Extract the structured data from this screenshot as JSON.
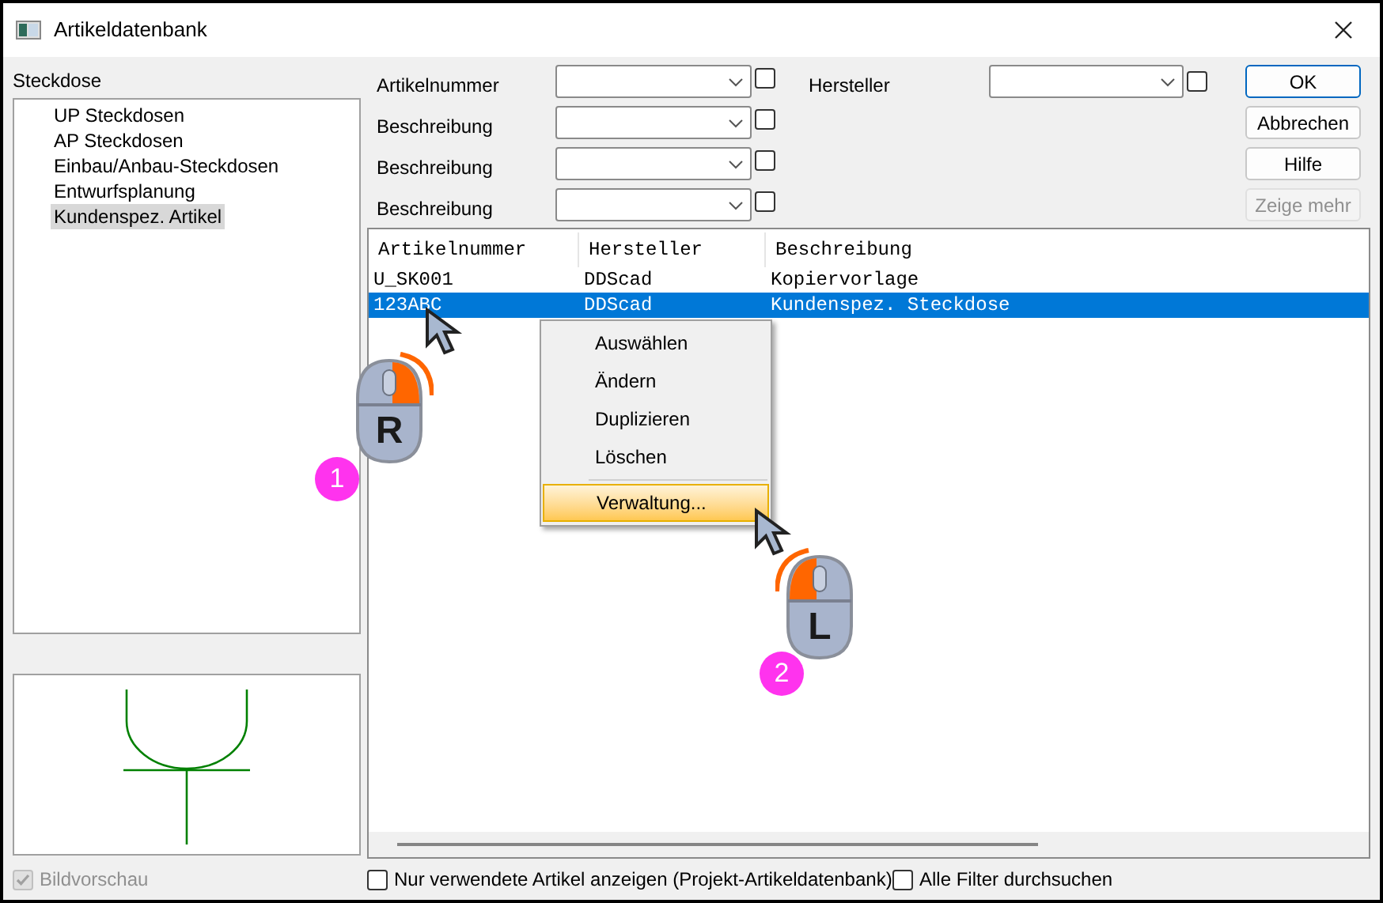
{
  "window": {
    "title": "Artikeldatenbank"
  },
  "category": {
    "label": "Steckdose"
  },
  "tree": [
    {
      "label": "UP Steckdosen",
      "selected": false
    },
    {
      "label": "AP Steckdosen",
      "selected": false
    },
    {
      "label": "Einbau/Anbau-Steckdosen",
      "selected": false
    },
    {
      "label": "Entwurfsplanung",
      "selected": false
    },
    {
      "label": "Kundenspez. Artikel",
      "selected": true
    }
  ],
  "preview": {
    "label": "Bildvorschau",
    "checked": true,
    "disabled": true
  },
  "filters": [
    {
      "label": "Artikelnummer",
      "checked": false
    },
    {
      "label": "Beschreibung",
      "checked": false
    },
    {
      "label": "Beschreibung",
      "checked": false
    },
    {
      "label": "Beschreibung",
      "checked": false
    }
  ],
  "manufacturer_filter": {
    "label": "Hersteller",
    "checked": false
  },
  "buttons": [
    {
      "label": "OK",
      "default": true,
      "disabled": false
    },
    {
      "label": "Abbrechen",
      "default": false,
      "disabled": false
    },
    {
      "label": "Hilfe",
      "default": false,
      "disabled": false
    },
    {
      "label": "Zeige mehr",
      "default": false,
      "disabled": true
    }
  ],
  "table": {
    "columns": [
      "Artikelnummer",
      "Hersteller",
      "Beschreibung"
    ],
    "rows": [
      {
        "cells": [
          "U_SK001",
          "DDScad",
          "Kopiervorlage"
        ],
        "selected": false
      },
      {
        "cells": [
          "123ABC",
          "DDScad",
          "Kundenspez. Steckdose"
        ],
        "selected": true
      }
    ]
  },
  "context_menu": [
    {
      "label": "Auswählen",
      "selected": false
    },
    {
      "label": "Ändern",
      "selected": false
    },
    {
      "label": "Duplizieren",
      "selected": false
    },
    {
      "label": "Löschen",
      "selected": false
    },
    {
      "label": "Verwaltung...",
      "selected": true,
      "separator_before": true
    }
  ],
  "options": [
    {
      "label": "Nur verwendete Artikel anzeigen (Projekt-Artikeldatenbank)",
      "checked": false
    },
    {
      "label": "Alle Filter durchsuchen",
      "checked": false
    }
  ],
  "annotations": [
    {
      "number": "1",
      "letter": "R",
      "kind": "right"
    },
    {
      "number": "2",
      "letter": "L",
      "kind": "left"
    }
  ]
}
